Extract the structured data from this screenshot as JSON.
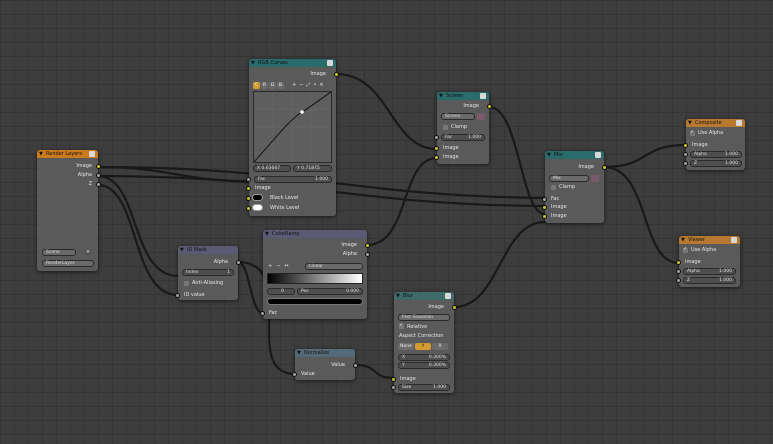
{
  "colors": {
    "grid_bg": "#3d3d3d",
    "link": "#191919",
    "socket_color": "#c7c729",
    "socket_value": "#a1a1a1",
    "socket_vector": "#6363c7"
  },
  "render_layers": {
    "title": "Render Layers",
    "outputs": [
      "Image",
      "Alpha",
      "Z"
    ],
    "scene": "Scene",
    "layer": "RenderLayer"
  },
  "rgb_curves": {
    "title": "RGB Curves",
    "output": "Image",
    "channels": [
      "C",
      "R",
      "G",
      "B"
    ],
    "tools": [
      "+",
      "−",
      "⤢",
      "•",
      "✕"
    ],
    "coord_x": "X 0.63667",
    "coord_y": "Y 0.71875",
    "fac_label": "Fac",
    "fac_value": "1.000",
    "inputs": [
      "Image",
      "Black Level",
      "White Level"
    ]
  },
  "screen": {
    "title": "Screen",
    "output": "Image",
    "mode": "Screen",
    "clamp": "Clamp",
    "fac_label": "Fac",
    "fac_value": "1.000",
    "inputs": [
      "Image",
      "Image"
    ]
  },
  "mix": {
    "title": "Mix",
    "output": "Image",
    "mode": "Mix",
    "clamp": "Clamp",
    "inputs": [
      "Fac",
      "Image",
      "Image"
    ]
  },
  "composite": {
    "title": "Composite",
    "use_alpha": "Use Alpha",
    "inputs": [
      "Image",
      "Alpha",
      "Z"
    ],
    "alpha_value": "1.000",
    "z_value": "1.000"
  },
  "viewer": {
    "title": "Viewer",
    "use_alpha": "Use Alpha",
    "inputs": [
      "Image",
      "Alpha",
      "Z"
    ],
    "alpha_value": "1.000",
    "z_value": "1.000"
  },
  "idmask": {
    "title": "ID Mask",
    "output": "Alpha",
    "index_label": "Index",
    "index_value": "1",
    "anti_alias": "Anti-Aliasing",
    "input": "ID value"
  },
  "colorramp": {
    "title": "ColorRamp",
    "outputs": [
      "Image",
      "Alpha"
    ],
    "tools": [
      "+",
      "−",
      "↔"
    ],
    "interp": "Linear",
    "stop_index": "0",
    "pos_label": "Pos",
    "pos_value": "0.000",
    "input": "Fac"
  },
  "blur": {
    "title": "Blur",
    "output": "Image",
    "filter": "Fast Gaussian",
    "relative": "Relative",
    "aspect_label": "Aspect Correction",
    "aspect_opts": [
      "None",
      "Y",
      "X"
    ],
    "x_label": "X",
    "x_value": "0.300%",
    "y_label": "Y",
    "y_value": "0.300%",
    "inputs": [
      "Image"
    ],
    "size_label": "Size",
    "size_value": "1.000"
  },
  "normalize": {
    "title": "Normalize",
    "output": "Value",
    "input": "Value"
  }
}
